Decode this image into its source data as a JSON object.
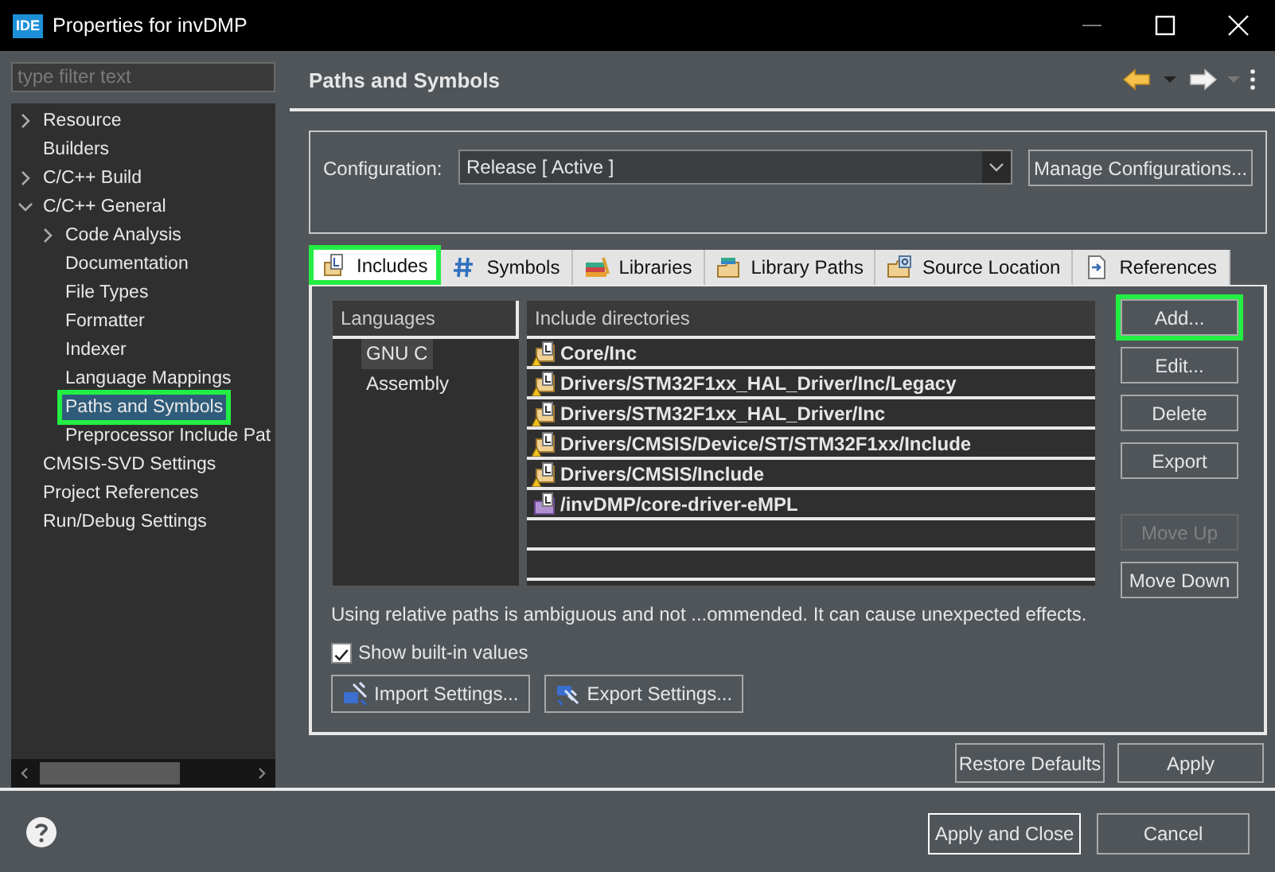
{
  "window": {
    "title": "Properties for invDMP",
    "app_badge": "IDE"
  },
  "sidebar": {
    "filter": {
      "placeholder": "type filter text"
    },
    "tree": [
      {
        "label": "Resource",
        "kind": "group",
        "expanded": false,
        "selected": false,
        "highlighted": false
      },
      {
        "label": "Builders",
        "kind": "leaf",
        "selected": false,
        "highlighted": false
      },
      {
        "label": "C/C++ Build",
        "kind": "group",
        "expanded": false,
        "selected": false,
        "highlighted": false
      },
      {
        "label": "C/C++ General",
        "kind": "group",
        "expanded": true,
        "selected": false,
        "highlighted": false,
        "children": [
          {
            "label": "Code Analysis",
            "kind": "group",
            "expanded": false,
            "selected": false,
            "highlighted": false
          },
          {
            "label": "Documentation",
            "kind": "leaf",
            "selected": false,
            "highlighted": false
          },
          {
            "label": "File Types",
            "kind": "leaf",
            "selected": false,
            "highlighted": false
          },
          {
            "label": "Formatter",
            "kind": "leaf",
            "selected": false,
            "highlighted": false
          },
          {
            "label": "Indexer",
            "kind": "leaf",
            "selected": false,
            "highlighted": false
          },
          {
            "label": "Language Mappings",
            "kind": "leaf",
            "selected": false,
            "highlighted": false
          },
          {
            "label": "Paths and Symbols",
            "kind": "leaf",
            "selected": true,
            "highlighted": true
          },
          {
            "label": "Preprocessor Include Pat",
            "kind": "leaf",
            "selected": false,
            "highlighted": false
          }
        ]
      },
      {
        "label": "CMSIS-SVD Settings",
        "kind": "leaf",
        "selected": false,
        "highlighted": false
      },
      {
        "label": "Project References",
        "kind": "leaf",
        "selected": false,
        "highlighted": false
      },
      {
        "label": "Run/Debug Settings",
        "kind": "leaf",
        "selected": false,
        "highlighted": false
      }
    ]
  },
  "page": {
    "title": "Paths and Symbols",
    "configuration": {
      "label": "Configuration:",
      "value": "Release  [ Active ]",
      "button": "Manage Configurations..."
    },
    "tabs": [
      {
        "label": "Includes",
        "kind": "includes",
        "selected": true,
        "highlighted": true
      },
      {
        "label": "Symbols",
        "kind": "symbols",
        "selected": false,
        "highlighted": false
      },
      {
        "label": "Libraries",
        "kind": "libraries",
        "selected": false,
        "highlighted": false
      },
      {
        "label": "Library Paths",
        "kind": "library-paths",
        "selected": false,
        "highlighted": false
      },
      {
        "label": "Source Location",
        "kind": "source",
        "selected": false,
        "highlighted": false
      },
      {
        "label": "References",
        "kind": "references",
        "selected": false,
        "highlighted": false
      }
    ],
    "languages": {
      "header": "Languages",
      "items": [
        {
          "label": "GNU C",
          "selected": true
        },
        {
          "label": "Assembly",
          "selected": false
        }
      ]
    },
    "directories": {
      "header": "Include directories",
      "rows": [
        {
          "path": "Core/Inc",
          "kind": "workspace"
        },
        {
          "path": "Drivers/STM32F1xx_HAL_Driver/Inc/Legacy",
          "kind": "workspace"
        },
        {
          "path": "Drivers/STM32F1xx_HAL_Driver/Inc",
          "kind": "workspace"
        },
        {
          "path": "Drivers/CMSIS/Device/ST/STM32F1xx/Include",
          "kind": "workspace"
        },
        {
          "path": "Drivers/CMSIS/Include",
          "kind": "workspace"
        },
        {
          "path": "/invDMP/core-driver-eMPL",
          "kind": "project"
        }
      ]
    },
    "buttons": [
      {
        "label": "Add...",
        "disabled": false,
        "highlighted": true
      },
      {
        "label": "Edit...",
        "disabled": false,
        "highlighted": false
      },
      {
        "label": "Delete",
        "disabled": false,
        "highlighted": false
      },
      {
        "label": "Export",
        "disabled": false,
        "highlighted": false
      }
    ],
    "move_buttons": [
      {
        "label": "Move Up",
        "disabled": true,
        "highlighted": false
      },
      {
        "label": "Move Down",
        "disabled": false,
        "highlighted": false
      }
    ],
    "warning": "Using relative paths is ambiguous and not ...ommended. It can cause unexpected effects.",
    "show_builtin": {
      "label": "Show built-in values",
      "checked": true
    },
    "settings_buttons": [
      {
        "label": "Import Settings...",
        "kind": "import"
      },
      {
        "label": "Export Settings...",
        "kind": "export"
      }
    ],
    "page_buttons": [
      "Restore Defaults",
      "Apply"
    ]
  },
  "footer": {
    "buttons": [
      {
        "label": "Apply and Close",
        "default": true
      },
      {
        "label": "Cancel",
        "default": false
      }
    ]
  }
}
